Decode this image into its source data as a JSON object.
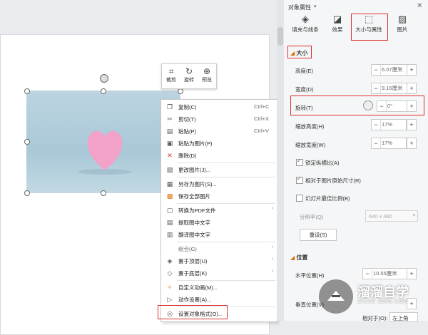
{
  "quick_toolbar": {
    "crop": {
      "label": "裁剪",
      "icon": "crop-icon"
    },
    "rotate": {
      "label": "旋转",
      "icon": "rotate-icon"
    },
    "preview": {
      "label": "预览",
      "icon": "zoom-icon"
    }
  },
  "context_menu": {
    "items": [
      {
        "label": "复制(C)",
        "shortcut": "Ctrl+C",
        "icon": "copy-icon"
      },
      {
        "label": "剪切(T)",
        "shortcut": "Ctrl+X",
        "icon": "cut-icon"
      },
      {
        "label": "粘贴(P)",
        "shortcut": "Ctrl+V",
        "icon": "paste-icon"
      },
      {
        "label": "粘贴为图片(P)",
        "shortcut": "",
        "icon": "paste-image-icon"
      },
      {
        "label": "删除(D)",
        "shortcut": "",
        "icon": "delete-icon"
      },
      {
        "label": "更改图片(J)...",
        "shortcut": "",
        "icon": "change-image-icon"
      },
      {
        "label": "另存为图片(S)...",
        "shortcut": "",
        "icon": "save-as-image-icon"
      },
      {
        "label": "保存全部图片",
        "shortcut": "",
        "icon": "save-all-images-icon"
      },
      {
        "label": "转换为PDF文件",
        "shortcut": "",
        "icon": "pdf-icon"
      },
      {
        "label": "提取图中文字",
        "shortcut": "",
        "icon": "extract-text-icon"
      },
      {
        "label": "翻译图中文字",
        "shortcut": "",
        "icon": "translate-icon"
      },
      {
        "label": "组合(G)",
        "shortcut": "",
        "icon": ""
      },
      {
        "label": "置于顶层(U)",
        "shortcut": "",
        "icon": "bring-to-front-icon"
      },
      {
        "label": "置于底层(K)",
        "shortcut": "",
        "icon": "send-to-back-icon"
      },
      {
        "label": "自定义动画(M)...",
        "shortcut": "",
        "icon": "animation-icon"
      },
      {
        "label": "动作设置(A)...",
        "shortcut": "",
        "icon": "action-icon"
      },
      {
        "label": "设置对象格式(O)...",
        "shortcut": "",
        "icon": "format-object-icon"
      }
    ]
  },
  "panel": {
    "title": "对象属性",
    "tabs": [
      {
        "label": "填充与线条",
        "icon": "fill-icon"
      },
      {
        "label": "效果",
        "icon": "effect-icon"
      },
      {
        "label": "大小与属性",
        "icon": "size-icon"
      },
      {
        "label": "图片",
        "icon": "picture-icon"
      }
    ],
    "size_section": "大小",
    "height_label": "高度(E)",
    "height_value": "6.07厘米",
    "width_label": "宽度(D)",
    "width_value": "9.16厘米",
    "rotation_label": "旋转(T)",
    "rotation_value": "0°",
    "scale_height_label": "缩放高度(H)",
    "scale_height_value": "17%",
    "scale_width_label": "缩放宽度(W)",
    "scale_width_value": "17%",
    "lock_ratio_label": "锁定纵横比(A)",
    "relative_original_label": "相对于图片原始尺寸(R)",
    "slideshow_label": "幻灯片最佳比例(B)",
    "resolution_label": "分辨率(Q)",
    "resolution_value": "640 x 480",
    "reset_label": "重设(S)",
    "position_section": "位置",
    "horizontal_label": "水平位置(H)",
    "horizontal_value": "10.55厘米",
    "vertical_label": "垂直位置(V)",
    "relative_to_label": "相对于(O):",
    "relative_to_value": "左上角"
  },
  "watermark": {
    "title": "溜溜自学",
    "url": "ZIXUE.3D66.COM"
  }
}
